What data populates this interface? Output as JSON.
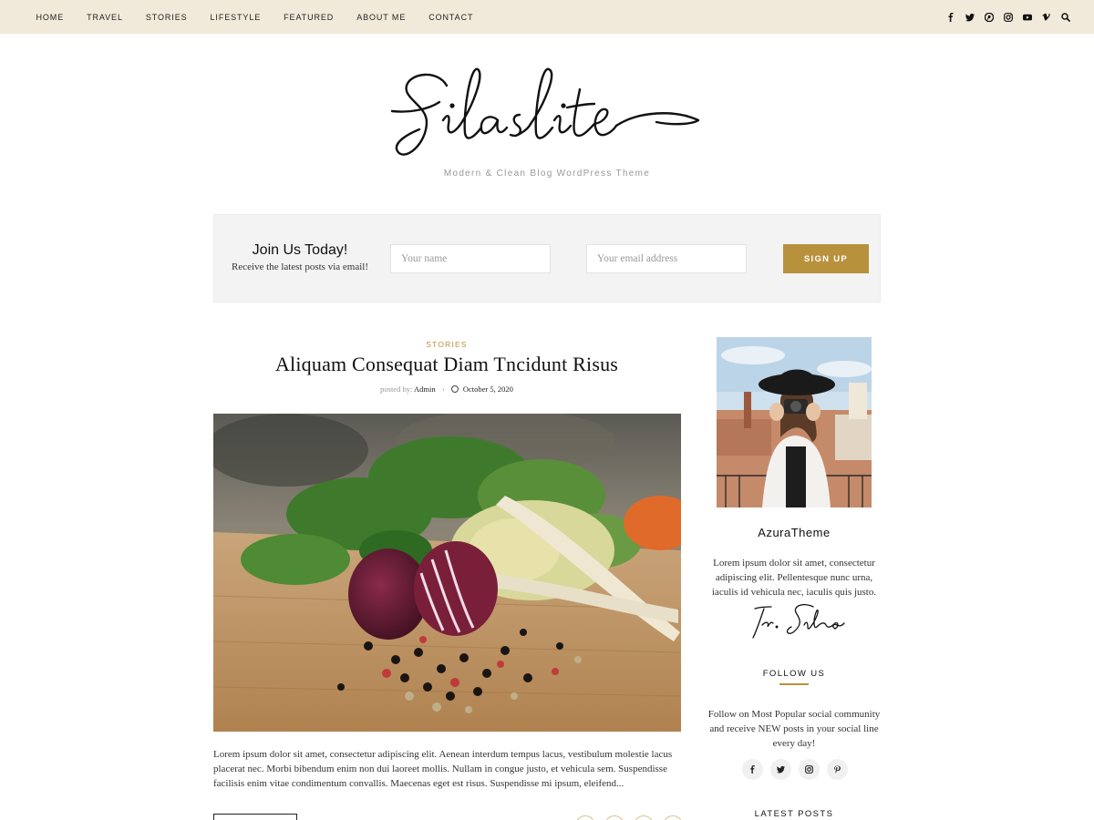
{
  "nav": {
    "items": [
      {
        "label": "HOME"
      },
      {
        "label": "TRAVEL"
      },
      {
        "label": "STORIES"
      },
      {
        "label": "LIFESTYLE"
      },
      {
        "label": "FEATURED"
      },
      {
        "label": "ABOUT ME"
      },
      {
        "label": "CONTACT"
      }
    ],
    "social_icons": [
      "facebook-icon",
      "twitter-icon",
      "pinterest-icon",
      "instagram-icon",
      "youtube-icon",
      "vimeo-icon",
      "search-icon"
    ]
  },
  "site": {
    "logo_text": "Silaslite",
    "tagline": "Modern & Clean Blog WordPress Theme"
  },
  "subscribe": {
    "title": "Join Us Today!",
    "text": "Receive the latest posts via email!",
    "name_placeholder": "Your name",
    "email_placeholder": "Your email address",
    "button_label": "SIGN UP"
  },
  "post": {
    "category": "STORIES",
    "title": "Aliquam Consequat Diam Tncidunt Risus",
    "posted_by_label": "posted by:",
    "author": "Admin",
    "separator": "›",
    "date": "October 5, 2020",
    "image_icon": "vegetables-photo",
    "excerpt": "Lorem ipsum dolor sit amet, consectetur adipiscing elit. Aenean interdum tempus lacus, vestibulum molestie lacus placerat nec. Morbi bibendum enim non dui laoreet mollis. Nullam in congue justo, et vehicula sem. Suspendisse facilisis enim vitae condimentum convallis. Maecenas eget est risus. Suspendisse mi ipsum, eleifend..."
  },
  "sidebar": {
    "about": {
      "name": "AzuraTheme",
      "text": "Lorem ipsum dolor sit amet, consectetur adipiscing elit. Pellentesque nunc urna, iaculis id vehicula nec, iaculis quis justo.",
      "signature": "Tr. Silas"
    },
    "follow": {
      "title": "FOLLOW US",
      "text": "Follow on Most Popular social community and receive NEW posts in your social line every day!",
      "icons": [
        "facebook-icon",
        "twitter-icon",
        "instagram-icon",
        "pinterest-icon"
      ]
    },
    "latest": {
      "title": "LATEST POSTS"
    }
  },
  "colors": {
    "topbar": "#f1eadb",
    "accent": "#b8913c"
  }
}
